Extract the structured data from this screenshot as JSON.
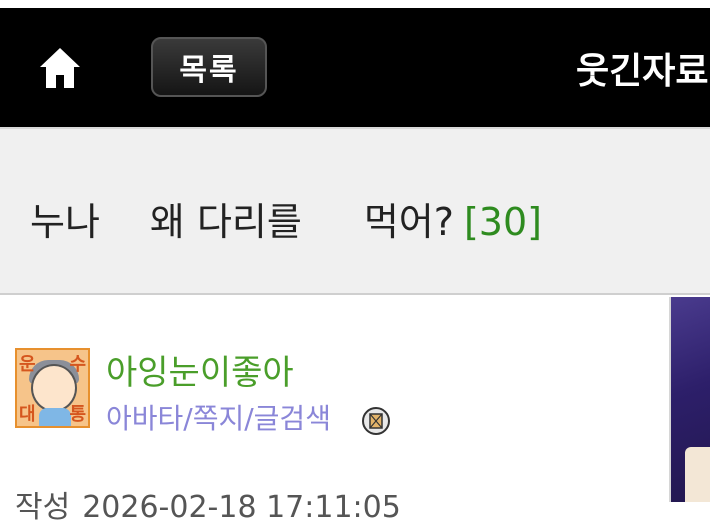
{
  "header": {
    "home_icon": "home-icon",
    "list_label": "목록",
    "board_title": "웃긴자료"
  },
  "post": {
    "title_part1": "누나",
    "title_part2": "왜 다리를",
    "title_part3": "먹어?",
    "comment_count": "[30]"
  },
  "author": {
    "avatar_icon": "avatar-image",
    "avatar_corner_text": [
      "운",
      "수",
      "대",
      "통"
    ],
    "nickname": "아잉눈이좋아",
    "links": "아바타/쪽지/글검색",
    "message_icon": "message-icon"
  },
  "meta": {
    "date_label": "작성",
    "date_value": "2026-02-18 17:11:05"
  },
  "colors": {
    "accent_green": "#2e8b1f",
    "nickname_green": "#4a9e2a",
    "link_purple": "#8a86d8"
  }
}
